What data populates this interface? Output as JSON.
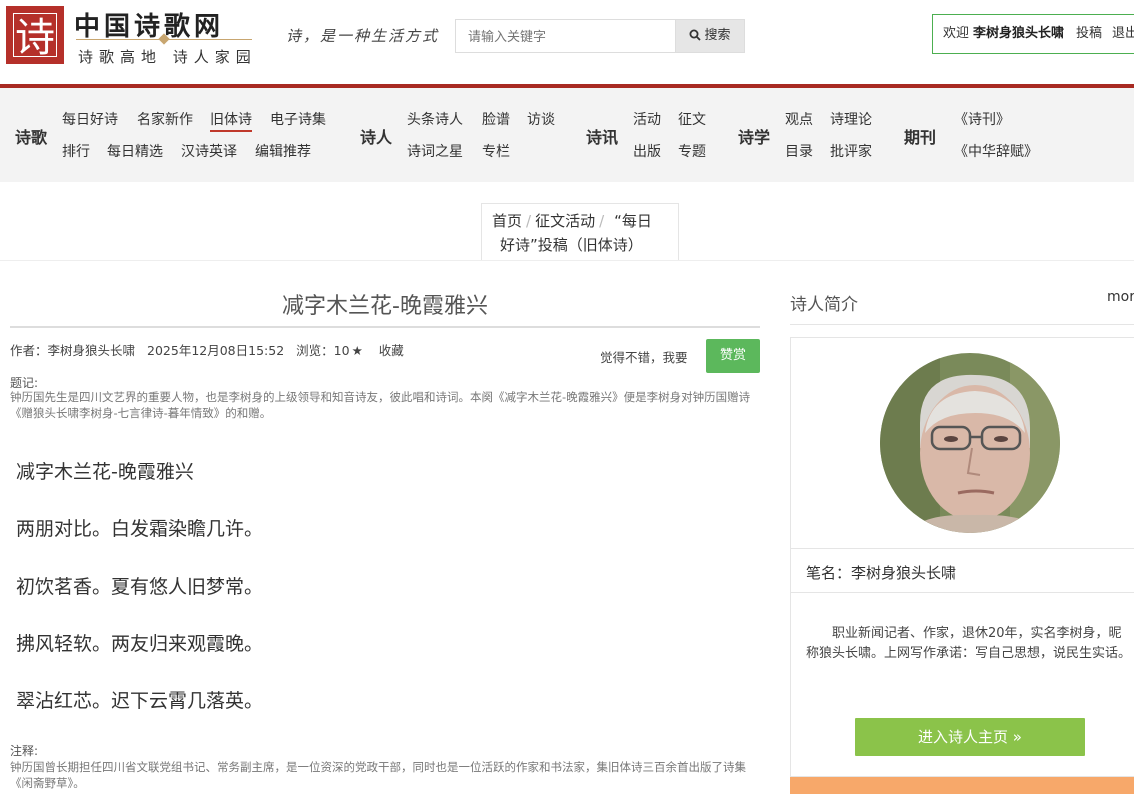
{
  "header": {
    "logo_glyph": "诗",
    "logo_title": "中国诗歌网",
    "logo_subtitle": "诗歌高地 诗人家园",
    "slogan": "诗，是一种生活方式",
    "search": {
      "placeholder": "请输入关键字",
      "button_label": "搜索"
    },
    "user": {
      "welcome": "欢迎",
      "username": "李树身狼头长啸",
      "submit_link": "投稿",
      "logout_link": "退出"
    }
  },
  "nav": {
    "groups": [
      {
        "category": "诗歌",
        "links": [
          "每日好诗",
          "名家新作",
          "旧体诗",
          "电子诗集",
          "排行",
          "每日精选",
          "汉诗英译",
          "编辑推荐"
        ],
        "active": "旧体诗"
      },
      {
        "category": "诗人",
        "links": [
          "头条诗人",
          "脸谱",
          "访谈",
          "诗词之星",
          "专栏"
        ]
      },
      {
        "category": "诗讯",
        "links": [
          "活动",
          "征文",
          "出版",
          "专题"
        ]
      },
      {
        "category": "诗学",
        "links": [
          "观点",
          "诗理论",
          "目录",
          "批评家"
        ]
      },
      {
        "category": "期刊",
        "links": [
          "《诗刊》",
          "《中华辞赋》"
        ]
      }
    ]
  },
  "breadcrumb": {
    "home": "首页",
    "section": "征文活动",
    "current_line1": "“每日",
    "current_line2": "好诗”投稿（旧体诗）"
  },
  "article": {
    "title": "减字木兰花-晚霞雅兴",
    "author": "作者：李树身狼头长啸",
    "date": "2025年12月08日15:52",
    "views": "浏览：10",
    "favorite": "收藏",
    "like_prompt": "觉得不错，我要",
    "praise_button": "赞赏",
    "preface_label": "题记:",
    "preface_text": "钟历国先生是四川文艺界的重要人物，也是李树身的上级领导和知音诗友，彼此唱和诗词。本阕《减字木兰花-晚霞雅兴》便是李树身对钟历国赠诗《赠狼头长啸李树身-七言律诗-暮年情致》的和赠。",
    "poem_lines": [
      "减字木兰花-晚霞雅兴",
      "两朋对比。白发霜染瞻几许。",
      "初饮茗香。夏有悠人旧梦常。",
      "拂风轻软。两友归来观霞晚。",
      "翠沾红芯。迟下云霄几落英。"
    ],
    "notes_label": "注释:",
    "notes_text": "钟历国曾长期担任四川省文联党组书记、常务副主席，是一位资深的党政干部，同时也是一位活跃的作家和书法家，集旧体诗三百余首出版了诗集《闲斋野草》。"
  },
  "sidebar": {
    "title": "诗人简介",
    "more": "more",
    "pen_name": "笔名：李树身狼头长啸",
    "bio": "职业新闻记者、作家，退休20年，实名李树身，昵称狼头长啸。上网写作承诺：写自己思想，说民生实话。",
    "enter_button": "进入诗人主页 »"
  },
  "colors": {
    "brand_red": "#a82a22",
    "praise_green": "#5cb85c",
    "enter_green": "#8bc34a",
    "user_box_border": "#4caf50"
  }
}
